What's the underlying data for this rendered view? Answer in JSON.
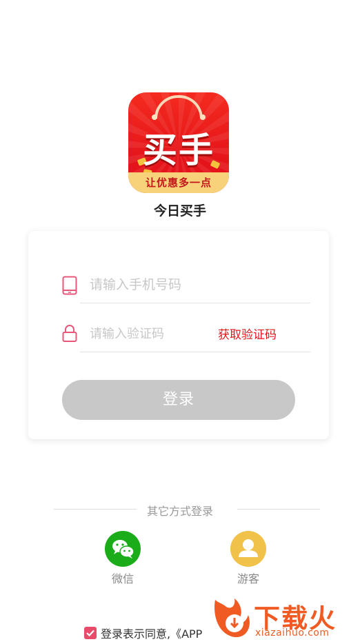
{
  "app": {
    "logo_main": "买手",
    "logo_ribbon": "让优惠多一点",
    "name": "今日买手"
  },
  "login": {
    "phone_placeholder": "请输入手机号码",
    "code_placeholder": "请输入验证码",
    "get_code_label": "获取验证码",
    "login_label": "登录"
  },
  "other": {
    "title": "其它方式登录",
    "wechat_label": "微信",
    "guest_label": "游客"
  },
  "agreement": {
    "checked": true,
    "text": "登录表示同意,《APP"
  },
  "watermark": {
    "text": "下载火",
    "url": "xiazaihuo.com"
  },
  "colors": {
    "accent": "#e4141a",
    "button_disabled": "#c8c8c8",
    "wechat": "#1aad19",
    "guest": "#f1c24a",
    "checkbox": "#e84a6a",
    "watermark": "#f05a23"
  },
  "icons": {
    "phone": "phone-icon",
    "lock": "lock-icon",
    "wechat": "wechat-icon",
    "guest": "user-icon",
    "check": "check-icon"
  }
}
